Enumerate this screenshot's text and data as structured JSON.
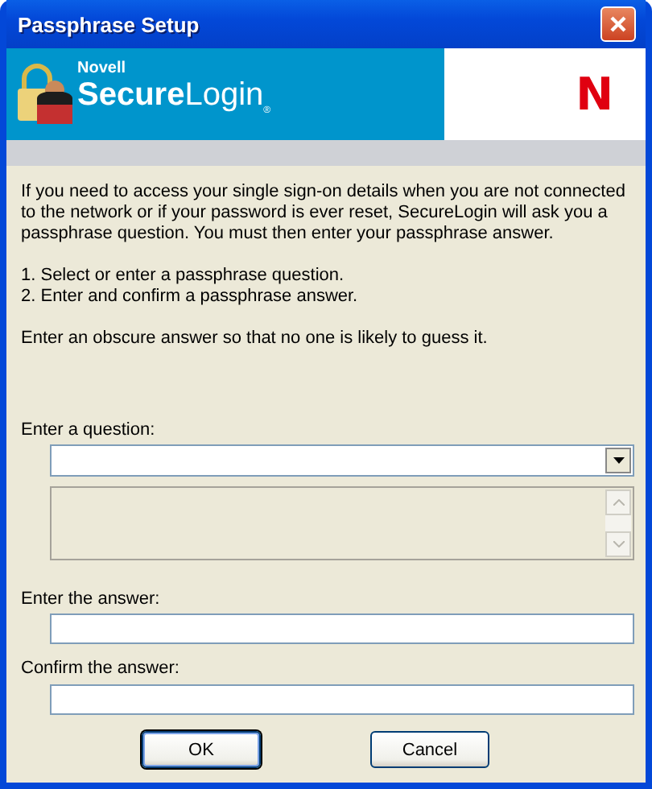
{
  "window": {
    "title": "Passphrase Setup"
  },
  "banner": {
    "vendor": "Novell",
    "product": "**Secure**Login$_{®}$",
    "logo": "N"
  },
  "instructions": [
    "If you need to access your single sign-on details when you are not connected to the network or if your password is ever reset, SecureLogin will ask you a passphrase question. You must then enter your passphrase answer.",
    "1. Select or enter a passphrase question.",
    "2. Enter and confirm a passphrase answer.",
    "Enter an obscure answer so that no one is likely to guess it."
  ],
  "question": {
    "label": "Enter a question:",
    "preview_disabled": true
  },
  "answer": {
    "label": "Enter the answer:"
  },
  "confirm": {
    "label": "Confirm the answer:"
  },
  "buttons": [
    {
      "label": "OK",
      "default": true
    },
    {
      "label": "Cancel",
      "default": false
    }
  ]
}
